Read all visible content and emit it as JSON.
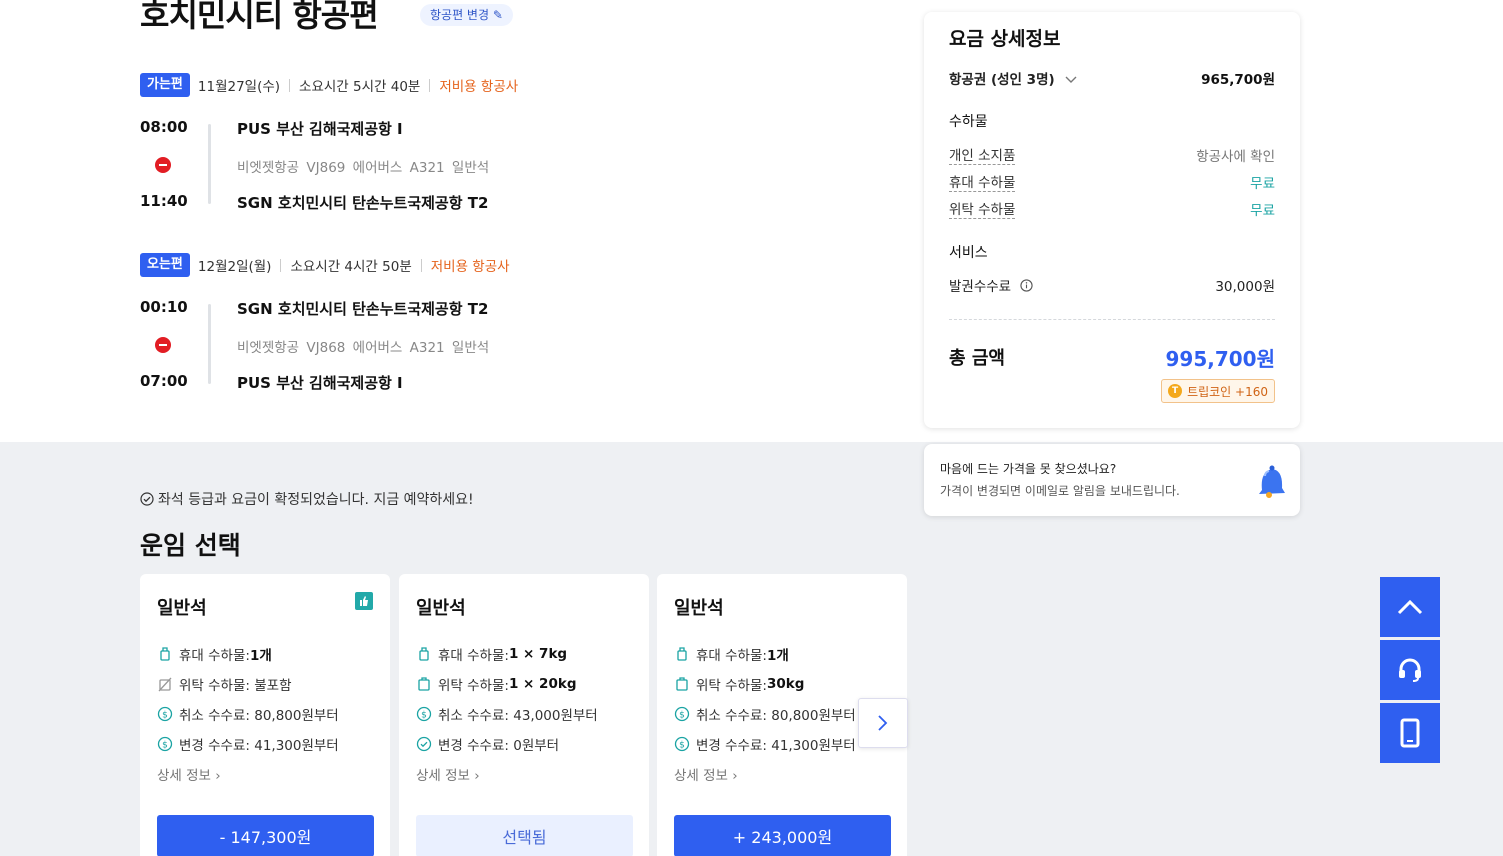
{
  "header": {
    "title": "호치민시티 항공편",
    "change_label": "항공편 변경"
  },
  "outbound": {
    "tag": "가는편",
    "date": "11월27일(수)",
    "duration": "소요시간 5시간 40분",
    "airline_type": "저비용 항공사",
    "dep_time": "08:00",
    "dep_airport": "PUS 부산 김해국제공항 I",
    "flight_info": "비엣젯항공 VJ869 에어버스 A321 일반석",
    "arr_time": "11:40",
    "arr_airport": "SGN 호치민시티 탄손누트국제공항 T2"
  },
  "inbound": {
    "tag": "오는편",
    "date": "12월2일(월)",
    "duration": "소요시간 4시간 50분",
    "airline_type": "저비용 항공사",
    "dep_time": "00:10",
    "dep_airport": "SGN 호치민시티 탄손누트국제공항 T2",
    "flight_info": "비엣젯항공 VJ868 에어버스 A321 일반석",
    "arr_time": "07:00",
    "arr_airport": "PUS 부산 김해국제공항 I"
  },
  "fare_panel": {
    "title": "요금 상세정보",
    "ticket_label": "항공권 (성인 3명)",
    "ticket_price": "965,700원",
    "baggage_section": "수하물",
    "personal_label": "개인 소지품",
    "personal_value": "항공사에 확인",
    "carry_label": "휴대 수하물",
    "carry_value": "무료",
    "checked_label": "위탁 수하물",
    "checked_value": "무료",
    "service_section": "서비스",
    "fee_label": "발권수수료",
    "fee_value": "30,000원",
    "total_label": "총 금액",
    "total_value": "995,700원",
    "coin_label": "트립코인 +160"
  },
  "price_alert": {
    "line1": "마음에 드는 가격을 못 찾으셨나요?",
    "line2": "가격이 변경되면 이메일로 알림을 보내드립니다."
  },
  "confirm_msg": "좌석 등급과 요금이 확정되었습니다. 지금 예약하세요!",
  "fare_section_title": "운임 선택",
  "fare_cards": [
    {
      "title": "일반석",
      "f1_label": "휴대 수하물: ",
      "f1_value": "1개",
      "f2_label": "위탁 수하물: 불포함",
      "f2_value": "",
      "f3_label": "취소 수수료: 80,800원부터",
      "f3_value": "",
      "f4_label": "변경 수수료: 41,300원부터",
      "f4_value": "",
      "more": "상세 정보",
      "button": "- 147,300원"
    },
    {
      "title": "일반석",
      "f1_label": "휴대 수하물: ",
      "f1_value": "1 × 7kg",
      "f2_label": "위탁 수하물: ",
      "f2_value": "1 × 20kg",
      "f3_label": "취소 수수료: 43,000원부터",
      "f3_value": "",
      "f4_label": "변경 수수료: 0원부터",
      "f4_value": "",
      "more": "상세 정보",
      "button": "선택됨"
    },
    {
      "title": "일반석",
      "f1_label": "휴대 수하물: ",
      "f1_value": "1개",
      "f2_label": "위탁 수하물: ",
      "f2_value": "30kg",
      "f3_label": "취소 수수료: 80,800원부터",
      "f3_value": "",
      "f4_label": "변경 수수료: 41,300원부터",
      "f4_value": "",
      "more": "상세 정보",
      "button": "+ 243,000원"
    }
  ],
  "colors": {
    "accent": "#2f5ff0",
    "lowcost": "#e5641e",
    "free": "#1aa3a3"
  }
}
